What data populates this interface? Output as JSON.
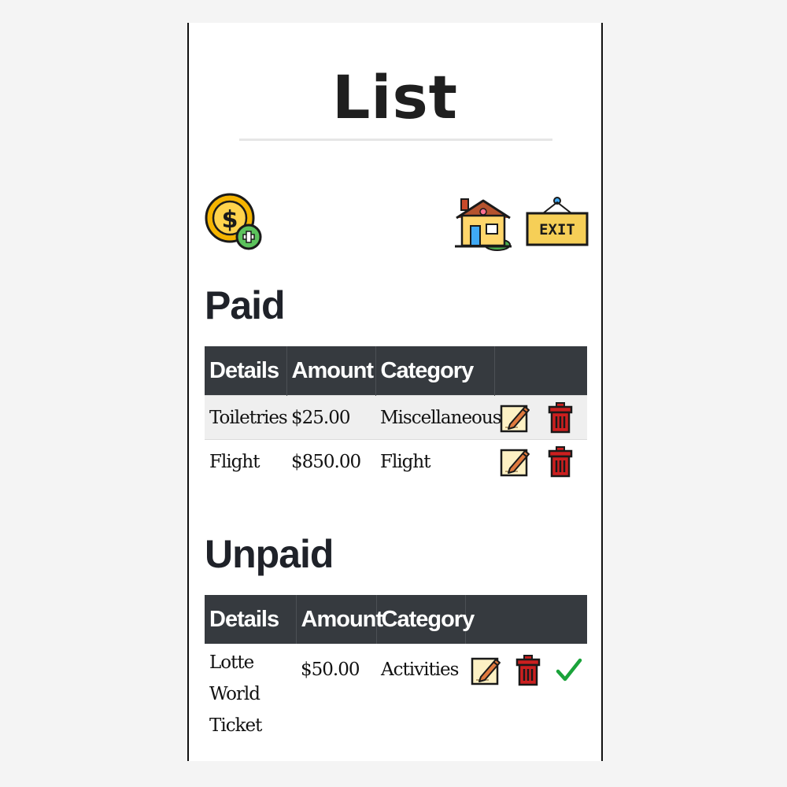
{
  "page": {
    "title": "List"
  },
  "toolbar": {
    "add_icon": "coin-add-icon",
    "home_icon": "home-icon",
    "exit_label": "EXIT"
  },
  "paid": {
    "title": "Paid",
    "columns": [
      "Details",
      "Amount",
      "Category",
      ""
    ],
    "rows": [
      {
        "details": "Toiletries",
        "amount": "$25.00",
        "category": "Miscellaneous"
      },
      {
        "details": "Flight",
        "amount": "$850.00",
        "category": "Flight"
      }
    ]
  },
  "unpaid": {
    "title": "Unpaid",
    "columns": [
      "Details",
      "Amount",
      "Category",
      ""
    ],
    "rows": [
      {
        "details": "Lotte World Ticket",
        "amount": "$50.00",
        "category": "Activities"
      }
    ]
  },
  "icons": {
    "edit": "edit-note-icon",
    "delete": "trash-icon",
    "mark_paid": "checkmark-icon"
  },
  "colors": {
    "header_bg": "#363a3f",
    "trash_red": "#cc1f1f",
    "check_green": "#1aa33a",
    "sign_yellow": "#f6cf57"
  }
}
